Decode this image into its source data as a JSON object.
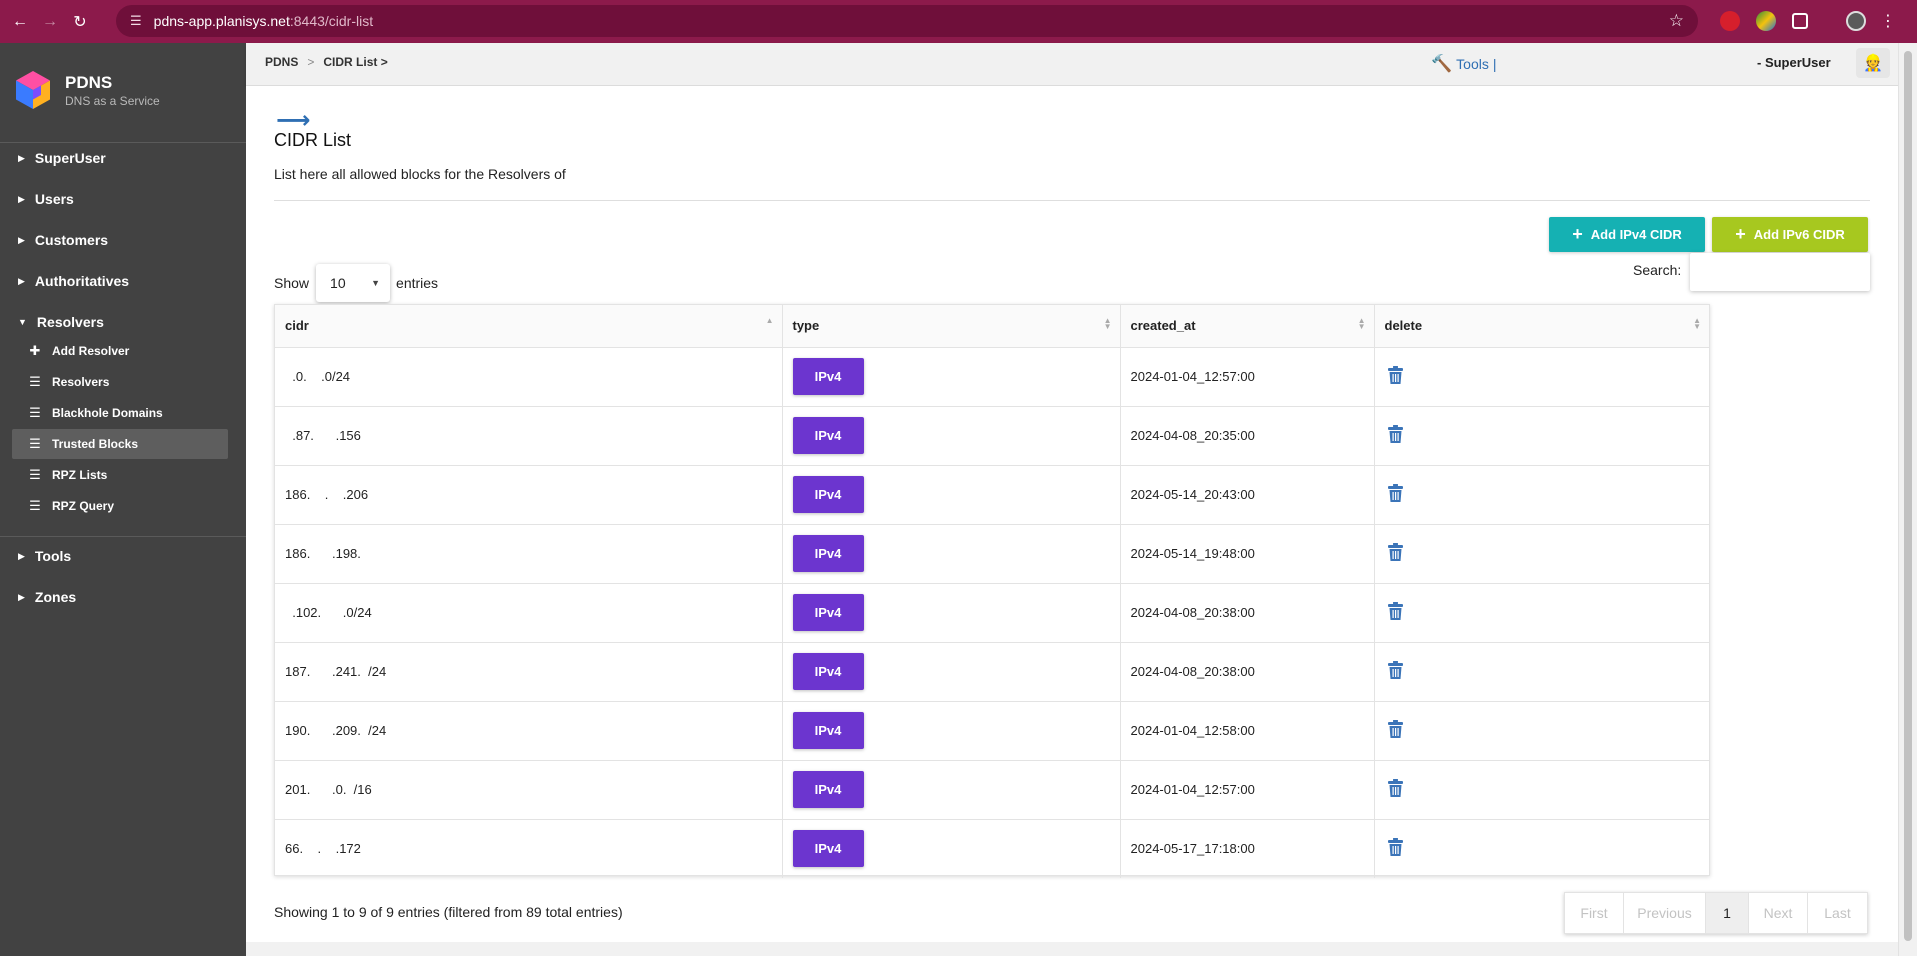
{
  "browser": {
    "url_host": "pdns-app.planisys.net",
    "url_rest": ":8443/cidr-list"
  },
  "brand": {
    "name": "PDNS",
    "subtitle": "DNS as a Service"
  },
  "sidebar": {
    "superuser": "SuperUser",
    "users": "Users",
    "customers": "Customers",
    "authoritatives": "Authoritatives",
    "resolvers": "Resolvers",
    "resolver_items": [
      {
        "label": "Add Resolver",
        "icon": "plus-icon"
      },
      {
        "label": "Resolvers",
        "icon": "list-icon"
      },
      {
        "label": "Blackhole Domains",
        "icon": "list-icon"
      },
      {
        "label": "Trusted Blocks",
        "icon": "list-icon"
      },
      {
        "label": "RPZ Lists",
        "icon": "list-icon"
      },
      {
        "label": "RPZ Query",
        "icon": "list-icon"
      }
    ],
    "tools": "Tools",
    "zones": "Zones"
  },
  "header": {
    "crumb_home": "PDNS",
    "crumb_sep": ">",
    "crumb_current": "CIDR List >",
    "tools_label": "Tools",
    "tools_sep": "|",
    "user_label": "- SuperUser"
  },
  "page": {
    "title": "CIDR List",
    "description": "List here all allowed blocks for the Resolvers of"
  },
  "actions": {
    "add_ipv4": "Add IPv4 CIDR",
    "add_ipv6": "Add IPv6 CIDR"
  },
  "length": {
    "show": "Show",
    "value": "10",
    "entries": "entries"
  },
  "search": {
    "label": "Search:",
    "value": ""
  },
  "table": {
    "columns": [
      "cidr",
      "type",
      "created_at",
      "delete"
    ],
    "rows": [
      {
        "cidr": "  .0.    .0/24",
        "type": "IPv4",
        "created_at": "2024-01-04_12:57:00"
      },
      {
        "cidr": "  .87.      .156",
        "type": "IPv4",
        "created_at": "2024-04-08_20:35:00"
      },
      {
        "cidr": "186.    .    .206",
        "type": "IPv4",
        "created_at": "2024-05-14_20:43:00"
      },
      {
        "cidr": "186.      .198.",
        "type": "IPv4",
        "created_at": "2024-05-14_19:48:00"
      },
      {
        "cidr": "  .102.      .0/24",
        "type": "IPv4",
        "created_at": "2024-04-08_20:38:00"
      },
      {
        "cidr": "187.      .241.  /24",
        "type": "IPv4",
        "created_at": "2024-04-08_20:38:00"
      },
      {
        "cidr": "190.      .209.  /24",
        "type": "IPv4",
        "created_at": "2024-01-04_12:58:00"
      },
      {
        "cidr": "201.      .0.  /16",
        "type": "IPv4",
        "created_at": "2024-01-04_12:57:00"
      },
      {
        "cidr": "66.    .    .172",
        "type": "IPv4",
        "created_at": "2024-05-17_17:18:00"
      }
    ]
  },
  "footer": {
    "showing": "Showing 1 to 9 of 9 entries (filtered from 89 total entries)",
    "pages": {
      "first": "First",
      "previous": "Previous",
      "current": "1",
      "next": "Next",
      "last": "Last"
    }
  },
  "colors": {
    "browser_bar": "#8c1a4b",
    "sidebar": "#424242",
    "ipv4_button": "#15b1b3",
    "ipv6_button": "#a7c81f",
    "type_badge": "#6c35cf",
    "trash": "#3b74b8"
  }
}
